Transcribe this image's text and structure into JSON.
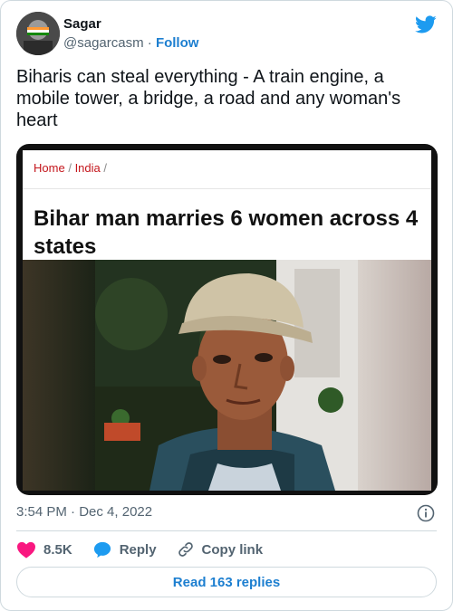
{
  "author": {
    "name": "Sagar",
    "handle": "@sagarcasm",
    "separator": "·",
    "follow_label": "Follow"
  },
  "tweet": {
    "text": "Biharis can steal everything - A train engine, a mobile tower, a bridge, a road and any woman's heart"
  },
  "media": {
    "breadcrumb": {
      "home": "Home",
      "sep1": "/",
      "section": "India",
      "sep2": "/"
    },
    "headline": "Bihar man marries 6 women across 4 states"
  },
  "meta": {
    "time": "3:54 PM",
    "separator": "·",
    "date": "Dec 4, 2022"
  },
  "actions": {
    "likes": "8.5K",
    "reply_label": "Reply",
    "copy_label": "Copy link"
  },
  "replies_button": "Read 163 replies",
  "colors": {
    "accent": "#1d9bf0",
    "like": "#f91880",
    "border": "#cfd9de",
    "secondary": "#536471",
    "breadcrumb_link": "#c4161c"
  }
}
